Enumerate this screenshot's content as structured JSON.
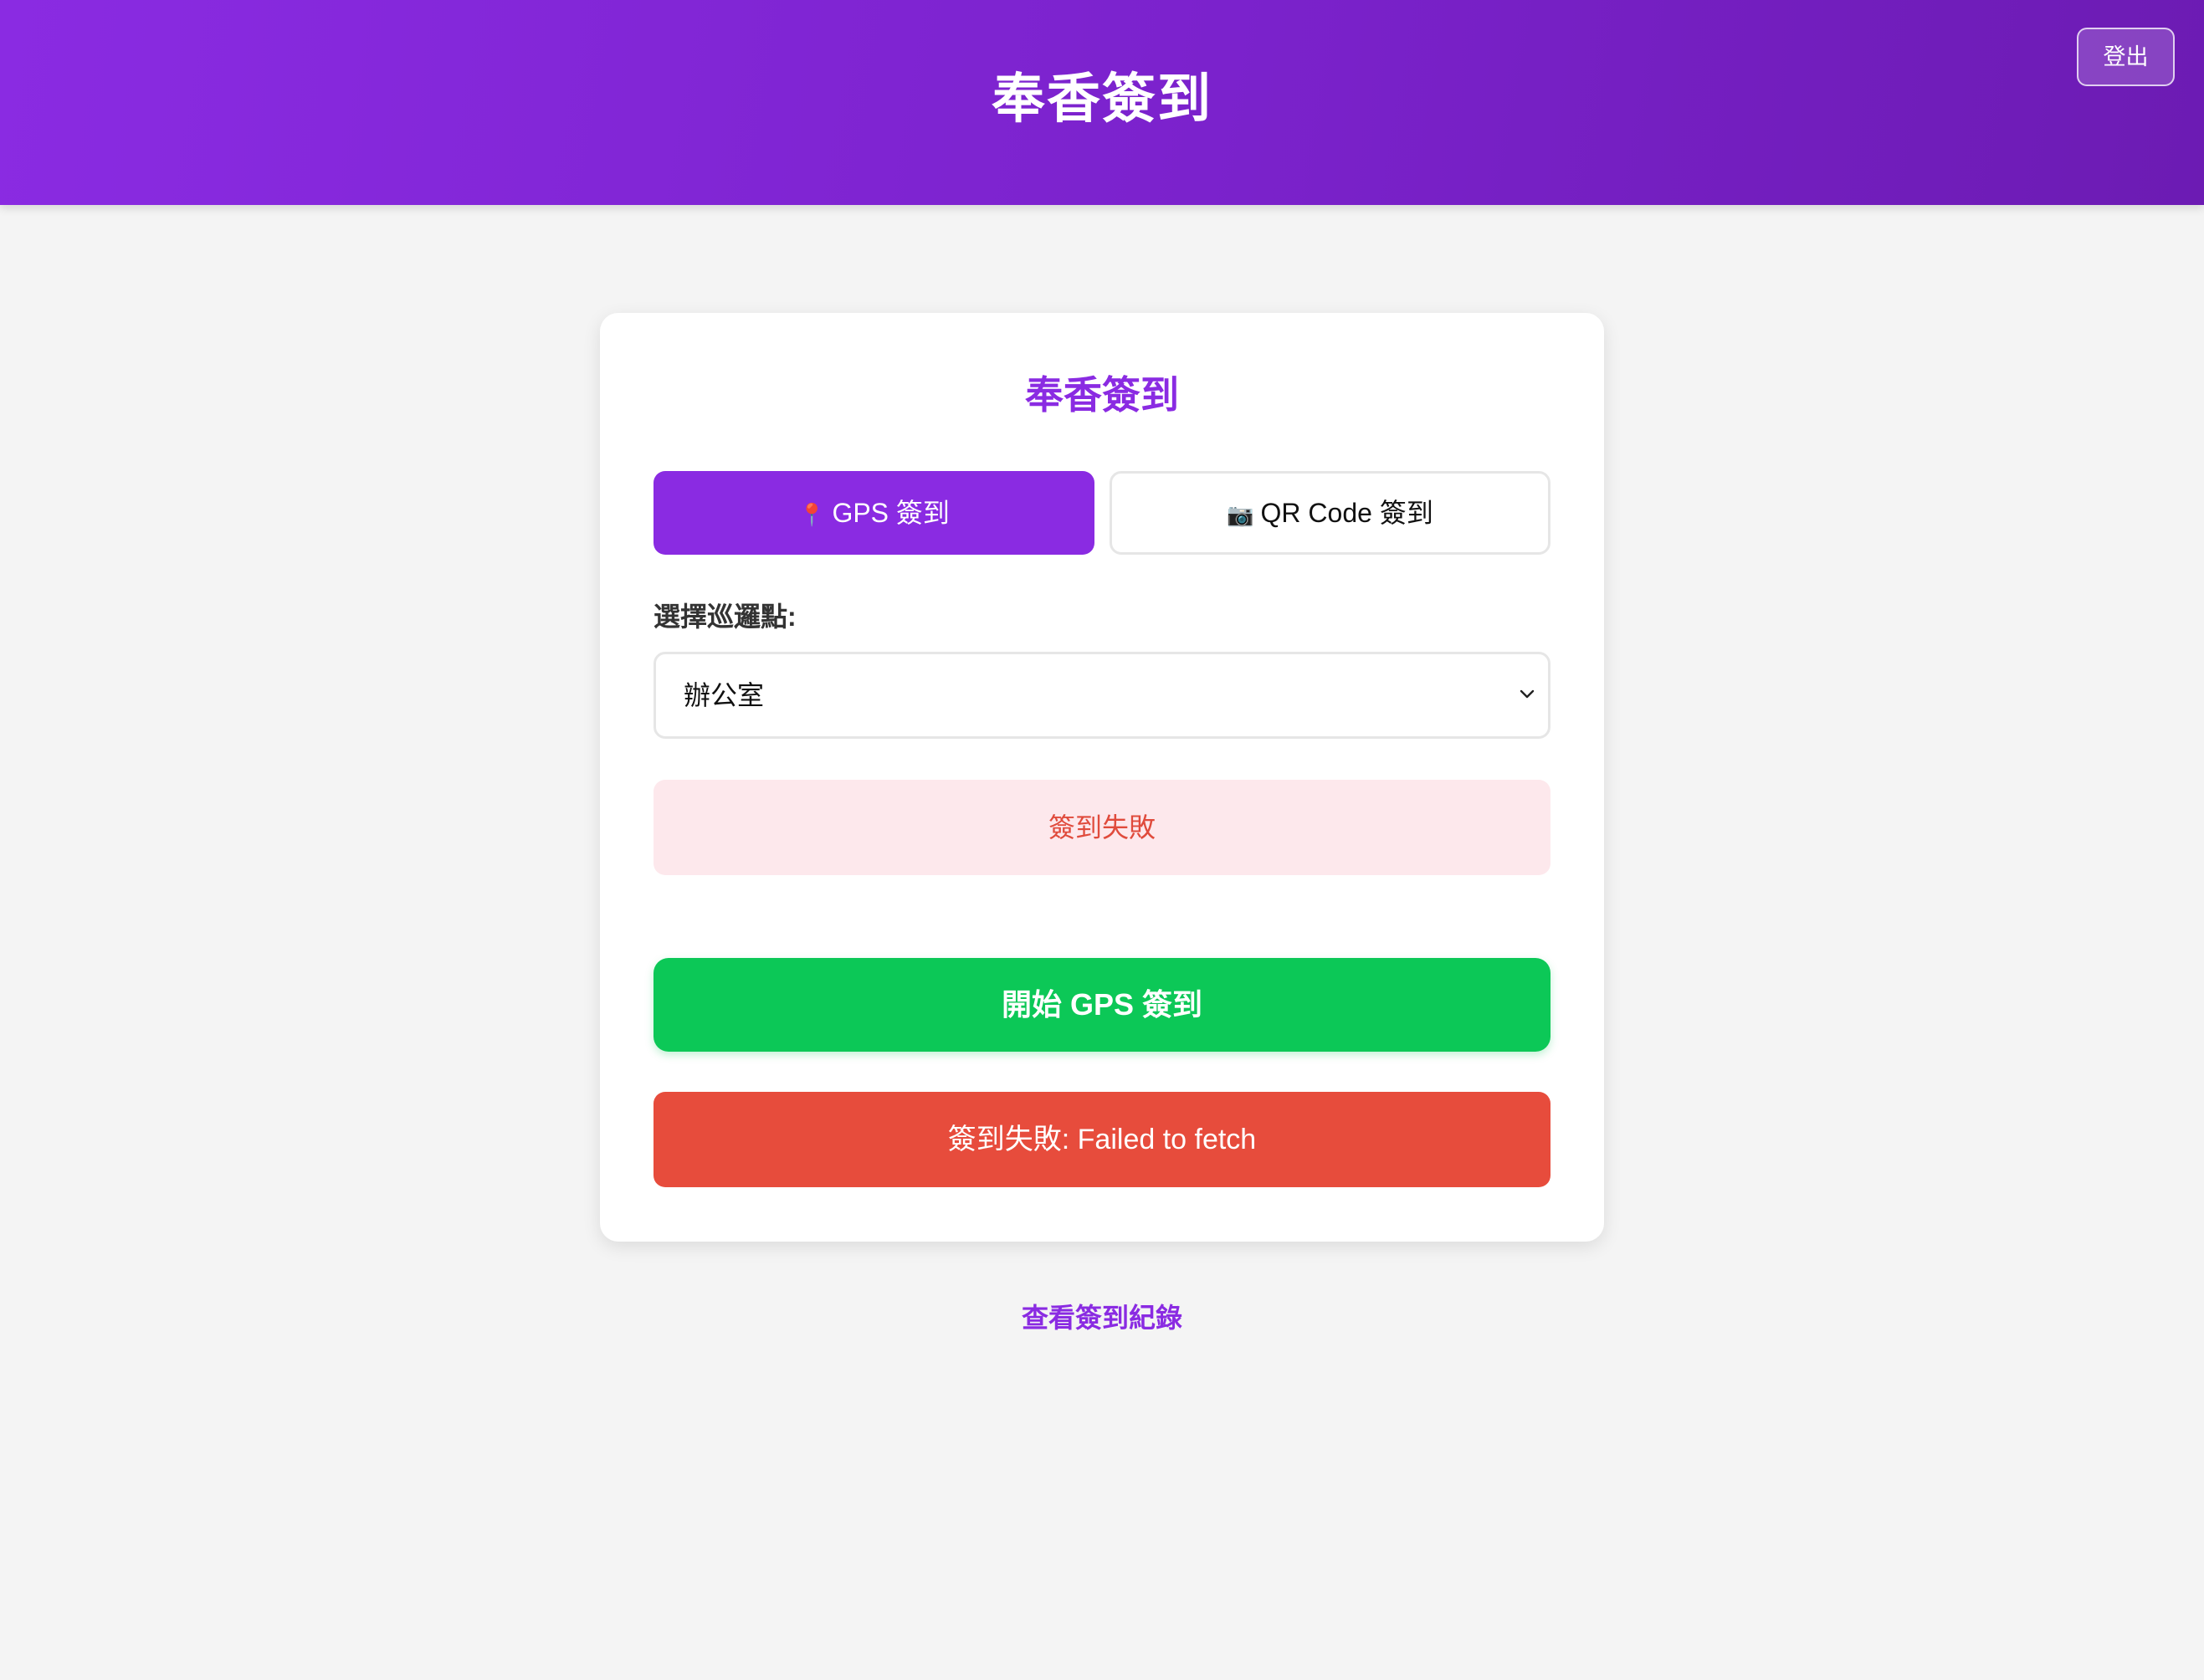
{
  "header": {
    "title": "奉香簽到",
    "logout_label": "登出"
  },
  "card": {
    "title": "奉香簽到",
    "tabs": [
      {
        "icon": "📍",
        "icon_name": "map-pin-icon",
        "label": "GPS 簽到",
        "active": true
      },
      {
        "icon": "📷",
        "icon_name": "camera-icon",
        "label": "QR Code 簽到",
        "active": false
      }
    ],
    "checkpoint_label": "選擇巡邏點:",
    "checkpoint_value": "辦公室",
    "status_message": "簽到失敗",
    "start_button_label": "開始 GPS 簽到",
    "error_message": "簽到失敗: Failed to fetch"
  },
  "records_link_label": "查看簽到紀錄",
  "colors": {
    "brand": "#8a2be2",
    "success": "#0cc857",
    "error": "#e74c3c",
    "error_bg": "#fde8ec"
  }
}
